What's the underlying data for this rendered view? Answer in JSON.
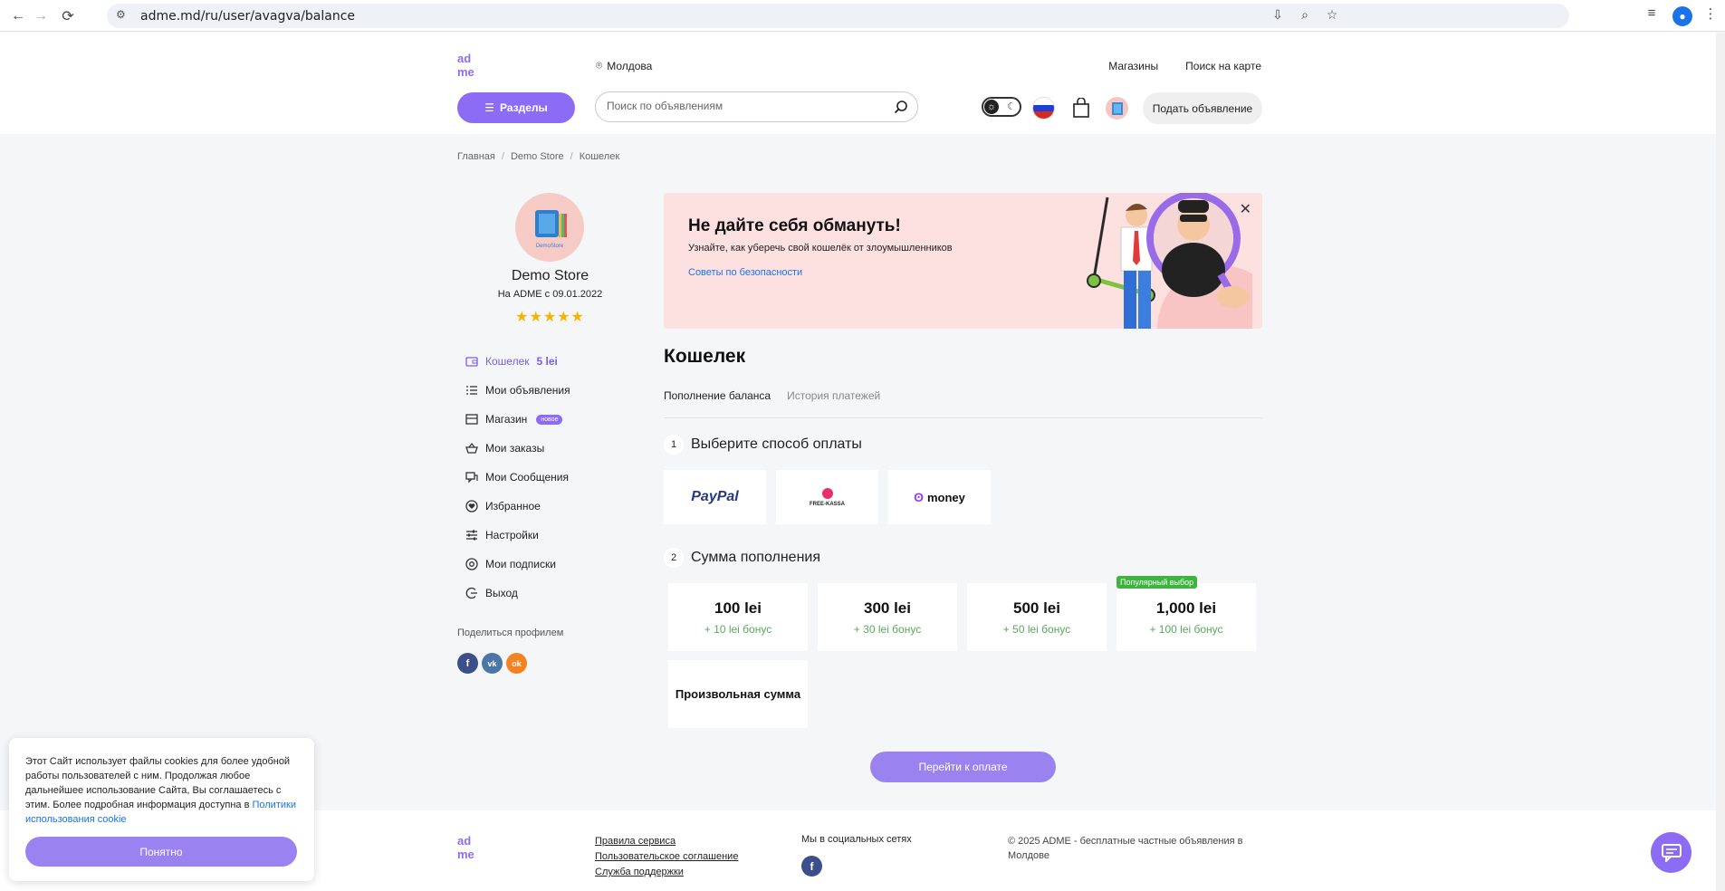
{
  "browser": {
    "url": "adme.md/ru/user/avagva/balance"
  },
  "header": {
    "location": "Молдова",
    "links": [
      "Магазины",
      "Поиск на карте"
    ],
    "sections_label": "Разделы",
    "search_placeholder": "Поиск по объявлениям",
    "post_ad_label": "Подать объявление"
  },
  "breadcrumb": [
    "Главная",
    "Demo Store",
    "Кошелек"
  ],
  "profile": {
    "avatar_text": "DemoStore",
    "name": "Demo Store",
    "since": "На ADME с 09.01.2022",
    "stars": "★★★★★",
    "rating": 5
  },
  "side_menu": {
    "wallet_label": "Кошелек",
    "wallet_balance": "5 lei",
    "my_ads": "Мои объявления",
    "store": "Магазин",
    "store_badge": "новое",
    "my_orders": "Мои заказы",
    "my_messages": "Мои Сообщения",
    "favorites": "Избранное",
    "settings": "Настройки",
    "subscriptions": "Мои подписки",
    "logout": "Выход"
  },
  "share": {
    "label": "Поделиться профилем",
    "networks": [
      "f",
      "vk",
      "ok"
    ]
  },
  "banner": {
    "title": "Не дайте себя обмануть!",
    "subtitle": "Узнайте, как уберечь свой кошелёк от злоумышленников",
    "link": "Советы по безопасности"
  },
  "wallet": {
    "title": "Кошелек",
    "tabs": [
      "Пополнение баланса",
      "История платежей"
    ],
    "step1_num": "1",
    "step1_label": "Выберите способ оплаты",
    "payment_methods": [
      "PayPal",
      "FREE-KASSA",
      "money"
    ],
    "step2_num": "2",
    "step2_label": "Сумма пополнения",
    "amounts": [
      {
        "value": "100 lei",
        "bonus": "+ 10 lei бонус"
      },
      {
        "value": "300 lei",
        "bonus": "+ 30 lei бонус"
      },
      {
        "value": "500 lei",
        "bonus": "+ 50 lei бонус"
      },
      {
        "value": "1,000 lei",
        "bonus": "+ 100 lei бонус",
        "tag": "Популярный выбор"
      }
    ],
    "custom_amount": "Произвольная сумма",
    "go_pay": "Перейти к оплате"
  },
  "footer": {
    "links": [
      "Правила сервиса",
      "Пользовательское соглашение",
      "Служба поддержки"
    ],
    "social_label": "Мы в социальных сетях",
    "copyright": "© 2025 ADME - бесплатные частные объявления в Молдове"
  },
  "cookie": {
    "text": "Этот Сайт использует файлы cookies для более удобной работы пользователей с ним. Продолжая любое дальнейшее использование Сайта, Вы соглашаетесь с этим. Более подробная информация доступна в ",
    "link": "Политики использования cookie",
    "button": "Понятно"
  },
  "colors": {
    "accent": "#8c6cf5",
    "banner_bg": "#fde1e1",
    "bonus_green": "#5aa95a",
    "popular_green": "#3db43d",
    "link_blue": "#1a73e8"
  }
}
